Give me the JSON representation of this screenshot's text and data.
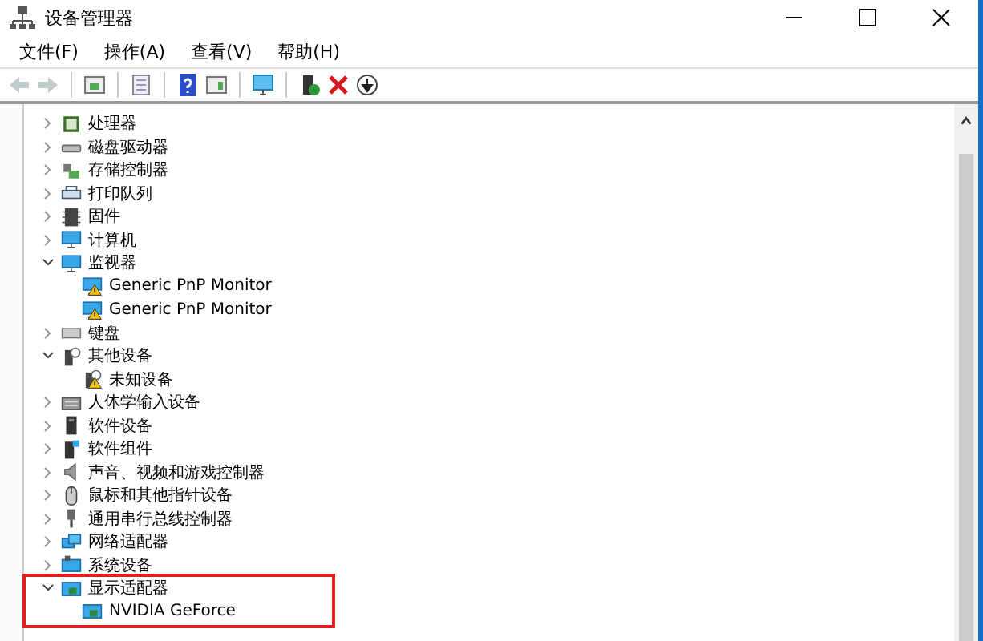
{
  "window": {
    "title": "设备管理器"
  },
  "menu": [
    {
      "label": "文件(F)"
    },
    {
      "label": "操作(A)"
    },
    {
      "label": "查看(V)"
    },
    {
      "label": "帮助(H)"
    }
  ],
  "toolbar": [
    {
      "kind": "back",
      "disabled": true
    },
    {
      "kind": "forward",
      "disabled": true
    },
    {
      "kind": "sep"
    },
    {
      "kind": "tree",
      "disabled": false
    },
    {
      "kind": "sep"
    },
    {
      "kind": "props",
      "disabled": false
    },
    {
      "kind": "sep"
    },
    {
      "kind": "help",
      "disabled": false
    },
    {
      "kind": "pane",
      "disabled": false
    },
    {
      "kind": "sep"
    },
    {
      "kind": "monitor",
      "disabled": false
    },
    {
      "kind": "sep"
    },
    {
      "kind": "add",
      "disabled": false
    },
    {
      "kind": "remove",
      "disabled": false
    },
    {
      "kind": "download",
      "disabled": false
    }
  ],
  "tree": [
    {
      "label": "处理器",
      "expanded": false
    },
    {
      "label": "磁盘驱动器",
      "expanded": false
    },
    {
      "label": "存储控制器",
      "expanded": false
    },
    {
      "label": "打印队列",
      "expanded": false
    },
    {
      "label": "固件",
      "expanded": false
    },
    {
      "label": "计算机",
      "expanded": false
    },
    {
      "label": "监视器",
      "expanded": true,
      "children": [
        {
          "label": "Generic PnP Monitor",
          "warning": true
        },
        {
          "label": "Generic PnP Monitor",
          "warning": true
        }
      ]
    },
    {
      "label": "键盘",
      "expanded": false
    },
    {
      "label": "其他设备",
      "expanded": true,
      "children": [
        {
          "label": "未知设备",
          "warning": true
        }
      ]
    },
    {
      "label": "人体学输入设备",
      "expanded": false
    },
    {
      "label": "软件设备",
      "expanded": false
    },
    {
      "label": "软件组件",
      "expanded": false
    },
    {
      "label": "声音、视频和游戏控制器",
      "expanded": false
    },
    {
      "label": "鼠标和其他指针设备",
      "expanded": false
    },
    {
      "label": "通用串行总线控制器",
      "expanded": false
    },
    {
      "label": "网络适配器",
      "expanded": false
    },
    {
      "label": "系统设备",
      "expanded": false
    },
    {
      "label": "显示适配器",
      "expanded": true,
      "outlined": true,
      "children": [
        {
          "label": "NVIDIA GeForce",
          "warning": false
        }
      ]
    }
  ]
}
